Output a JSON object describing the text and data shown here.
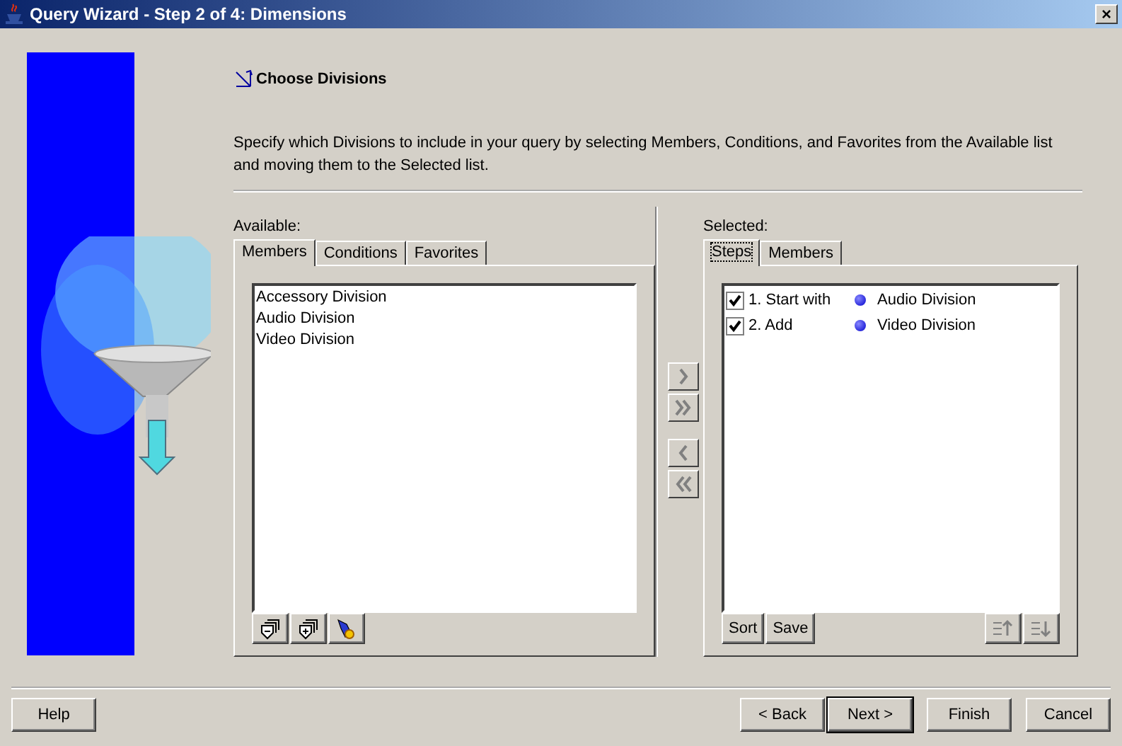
{
  "window": {
    "title": "Query Wizard - Step 2 of 4: Dimensions",
    "close": "×"
  },
  "header": {
    "title": "Choose Divisions"
  },
  "description": "Specify which Divisions to include in your query by selecting Members, Conditions, and Favorites from the Available list and moving them to the Selected list.",
  "available": {
    "label": "Available:",
    "tabs": [
      {
        "label": "Members",
        "selected": true
      },
      {
        "label": "Conditions",
        "selected": false
      },
      {
        "label": "Favorites",
        "selected": false
      }
    ],
    "items": [
      "Accessory Division",
      "Audio Division",
      "Video Division"
    ],
    "tools": [
      {
        "kind": "collapse"
      },
      {
        "kind": "expand"
      },
      {
        "kind": "find"
      }
    ]
  },
  "moves": [
    {
      "kind": "right",
      "disabled": true
    },
    {
      "kind": "all-right",
      "disabled": true
    },
    {
      "kind": "left",
      "disabled": true
    },
    {
      "kind": "all-left",
      "disabled": true
    }
  ],
  "selected": {
    "label": "Selected:",
    "tabs": [
      {
        "label": "Steps",
        "selected": true
      },
      {
        "label": "Members",
        "selected": false
      }
    ],
    "steps": [
      {
        "step": "1. Start with",
        "value": "Audio Division",
        "checked": true
      },
      {
        "step": "2. Add",
        "value": "Video Division",
        "checked": true
      }
    ],
    "buttons": [
      "Sort",
      "Save"
    ],
    "order": [
      {
        "kind": "up",
        "disabled": true
      },
      {
        "kind": "down",
        "disabled": true
      }
    ]
  },
  "footer": {
    "help": "Help",
    "buttons": [
      {
        "label": "< Back",
        "default": false
      },
      {
        "label": "Next >",
        "default": true
      },
      {
        "label": "Finish",
        "default": false
      },
      {
        "label": "Cancel",
        "default": false
      }
    ]
  }
}
